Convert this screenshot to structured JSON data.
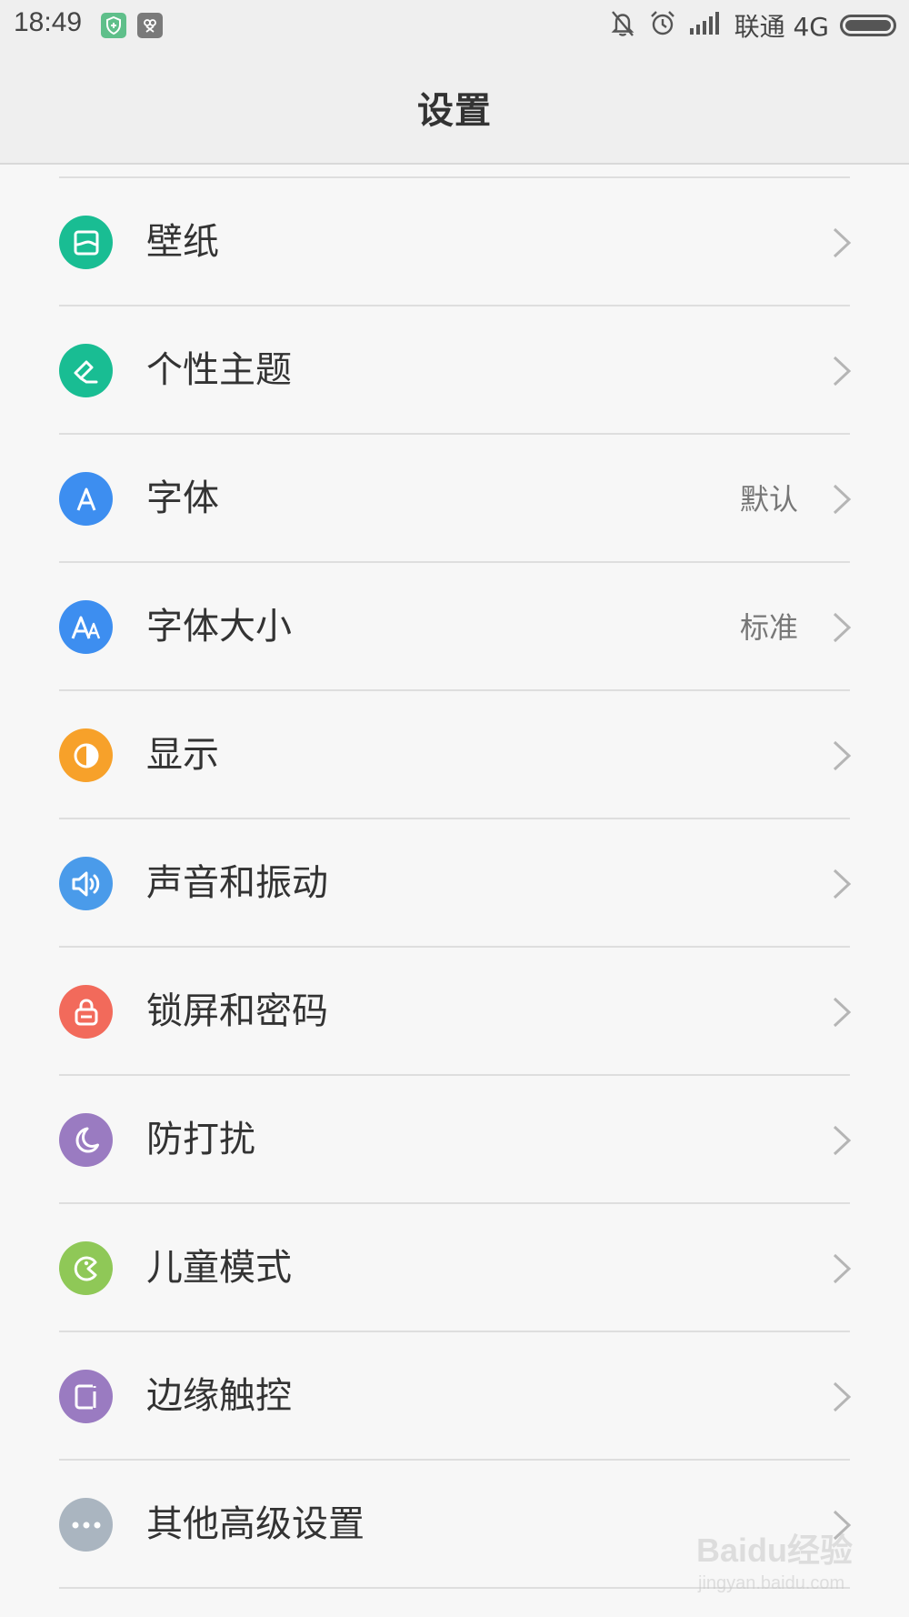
{
  "status_bar": {
    "time": "18:49",
    "carrier": "联通 4G"
  },
  "header": {
    "title": "设置"
  },
  "items": [
    {
      "label": "壁纸",
      "value": "",
      "icon": "wallpaper-icon",
      "color": "#19bd93"
    },
    {
      "label": "个性主题",
      "value": "",
      "icon": "theme-brush-icon",
      "color": "#19bd93"
    },
    {
      "label": "字体",
      "value": "默认",
      "icon": "font-icon",
      "color": "#3d8ef0"
    },
    {
      "label": "字体大小",
      "value": "标准",
      "icon": "font-size-icon",
      "color": "#3d8ef0"
    },
    {
      "label": "显示",
      "value": "",
      "icon": "display-icon",
      "color": "#f7a12a"
    },
    {
      "label": "声音和振动",
      "value": "",
      "icon": "speaker-icon",
      "color": "#4a9bea"
    },
    {
      "label": "锁屏和密码",
      "value": "",
      "icon": "lock-icon",
      "color": "#f26a5b"
    },
    {
      "label": "防打扰",
      "value": "",
      "icon": "moon-icon",
      "color": "#9a7bc1"
    },
    {
      "label": "儿童模式",
      "value": "",
      "icon": "kid-mode-icon",
      "color": "#8fc857"
    },
    {
      "label": "边缘触控",
      "value": "",
      "icon": "edge-touch-icon",
      "color": "#9a7bc1"
    },
    {
      "label": "其他高级设置",
      "value": "",
      "icon": "more-dots-icon",
      "color": "#aab5c0"
    }
  ],
  "watermark": {
    "brand": "Baidu经验",
    "url": "jingyan.baidu.com"
  }
}
